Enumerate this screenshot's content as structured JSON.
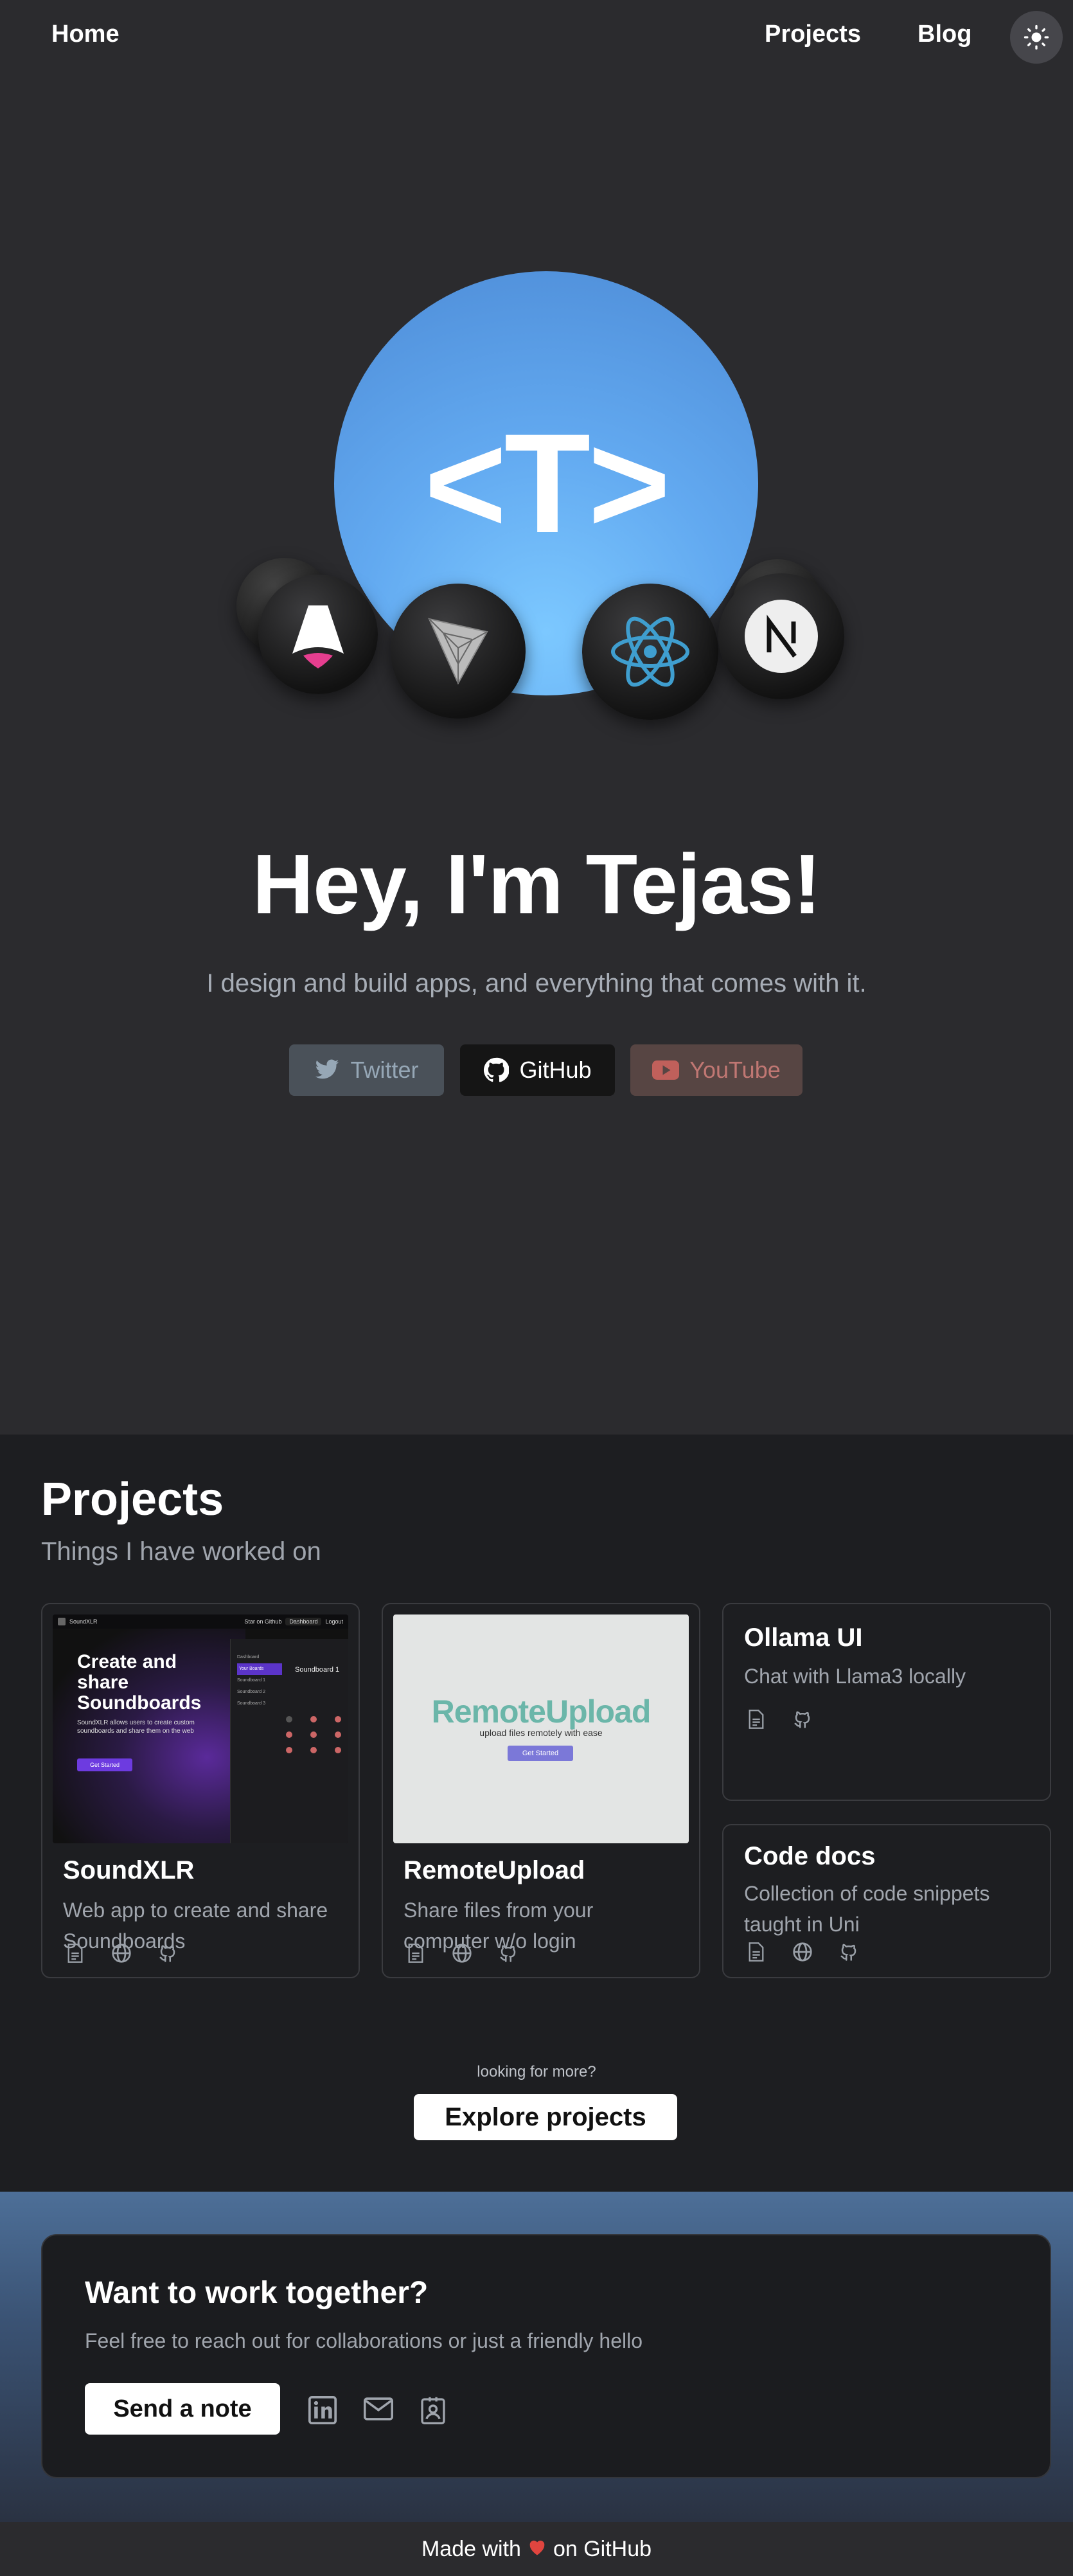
{
  "nav": {
    "home": "Home",
    "projects": "Projects",
    "blog": "Blog",
    "theme_icon": "sun-icon"
  },
  "hero": {
    "logo_text": "<T>",
    "title": "Hey, I'm Tejas!",
    "subtitle": "I design and build apps, and everything that comes with it.",
    "tech_icons": [
      "astro-icon",
      "vite-icon",
      "react-icon",
      "nextjs-icon"
    ],
    "links": [
      {
        "label": "Twitter",
        "icon": "twitter-icon"
      },
      {
        "label": "GitHub",
        "icon": "github-icon"
      },
      {
        "label": "YouTube",
        "icon": "youtube-icon"
      }
    ]
  },
  "projects": {
    "title": "Projects",
    "subtitle": "Things I have worked on",
    "items": [
      {
        "name": "SoundXLR",
        "description": "Web app to create and share Soundboards",
        "preview": {
          "brand": "SoundXLR",
          "nav_links": [
            "Star on Github",
            "Dashboard",
            "Logout"
          ],
          "headline": "Create and share Soundboards",
          "blurb": "SoundXLR allows users to create custom soundboards and share them on the web",
          "cta": "Get Started",
          "panel_title": "Soundboard 1",
          "sidebar_items": [
            "Dashboard",
            "Your Boards",
            "Soundboard 1",
            "Soundboard 2",
            "Soundboard 3"
          ]
        }
      },
      {
        "name": "RemoteUpload",
        "description": "Share files from your computer w/o login",
        "preview": {
          "brand": "RemoteUpload",
          "tagline": "upload files remotely with ease",
          "cta": "Get Started"
        }
      },
      {
        "name": "Ollama UI",
        "description": "Chat with Llama3 locally"
      },
      {
        "name": "Code docs",
        "description": "Collection of code snippets taught in Uni"
      }
    ],
    "more_label": "looking for more?",
    "explore_button": "Explore projects"
  },
  "contact": {
    "title": "Want to work together?",
    "subtitle": "Feel free to reach out for collaborations or just a friendly hello",
    "button": "Send a note",
    "icons": [
      "linkedin-icon",
      "mail-icon",
      "contact-card-icon"
    ]
  },
  "footer": {
    "prefix": "Made with",
    "suffix": "on GitHub"
  },
  "colors": {
    "hero_bg": "#2b2b2e",
    "projects_bg": "#1d1e21",
    "orb_blue": "#62a9f0",
    "twitter_bg": "#4a5159",
    "youtube_bg": "#574543"
  }
}
